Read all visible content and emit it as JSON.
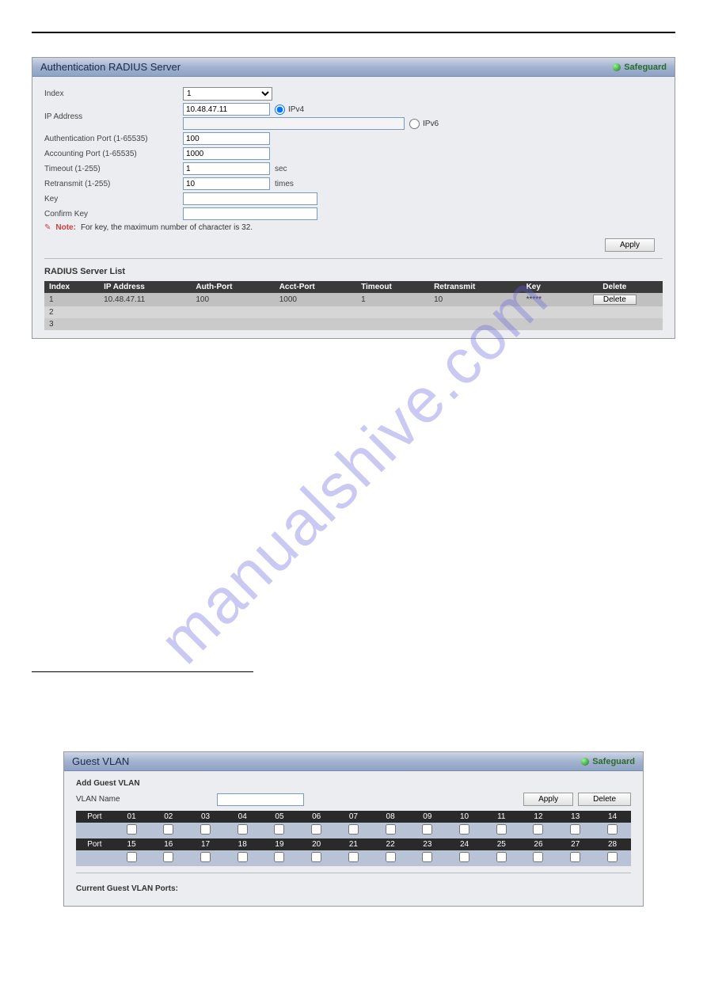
{
  "watermark": "manualshive.com",
  "radius_panel": {
    "title": "Authentication RADIUS Server",
    "safeguard": "Safeguard",
    "form": {
      "index_label": "Index",
      "index_value": "1",
      "ip_label": "IP Address",
      "ip_v4_value": "10.48.47.11",
      "ipv4_label": "IPv4",
      "ip_v6_value": "",
      "ipv6_label": "IPv6",
      "auth_port_label": "Authentication Port (1-65535)",
      "auth_port_value": "100",
      "acct_port_label": "Accounting Port (1-65535)",
      "acct_port_value": "1000",
      "timeout_label": "Timeout (1-255)",
      "timeout_value": "1",
      "timeout_suffix": "sec",
      "retransmit_label": "Retransmit (1-255)",
      "retransmit_value": "10",
      "retransmit_suffix": "times",
      "key_label": "Key",
      "key_value": "",
      "confirm_key_label": "Confirm Key",
      "confirm_key_value": "",
      "note_label": "Note:",
      "note_text": "For key, the maximum number of character is 32.",
      "apply_label": "Apply"
    },
    "list_title": "RADIUS Server List",
    "list": {
      "headers": {
        "index": "Index",
        "ip": "IP Address",
        "auth": "Auth-Port",
        "acct": "Acct-Port",
        "timeout": "Timeout",
        "retransmit": "Retransmit",
        "key": "Key",
        "delete": "Delete"
      },
      "rows": [
        {
          "index": "1",
          "ip": "10.48.47.11",
          "auth": "100",
          "acct": "1000",
          "timeout": "1",
          "retransmit": "10",
          "key": "*****",
          "delete": "Delete"
        },
        {
          "index": "2",
          "ip": "",
          "auth": "",
          "acct": "",
          "timeout": "",
          "retransmit": "",
          "key": "",
          "delete": ""
        },
        {
          "index": "3",
          "ip": "",
          "auth": "",
          "acct": "",
          "timeout": "",
          "retransmit": "",
          "key": "",
          "delete": ""
        }
      ]
    }
  },
  "guest_panel": {
    "title": "Guest VLAN",
    "safeguard": "Safeguard",
    "add_title": "Add Guest VLAN",
    "vlan_name_label": "VLAN Name",
    "vlan_name_value": "",
    "apply_label": "Apply",
    "delete_label": "Delete",
    "port_label": "Port",
    "ports_row1": [
      "01",
      "02",
      "03",
      "04",
      "05",
      "06",
      "07",
      "08",
      "09",
      "10",
      "11",
      "12",
      "13",
      "14"
    ],
    "ports_row2": [
      "15",
      "16",
      "17",
      "18",
      "19",
      "20",
      "21",
      "22",
      "23",
      "24",
      "25",
      "26",
      "27",
      "28"
    ],
    "current_label": "Current Guest VLAN Ports:"
  }
}
